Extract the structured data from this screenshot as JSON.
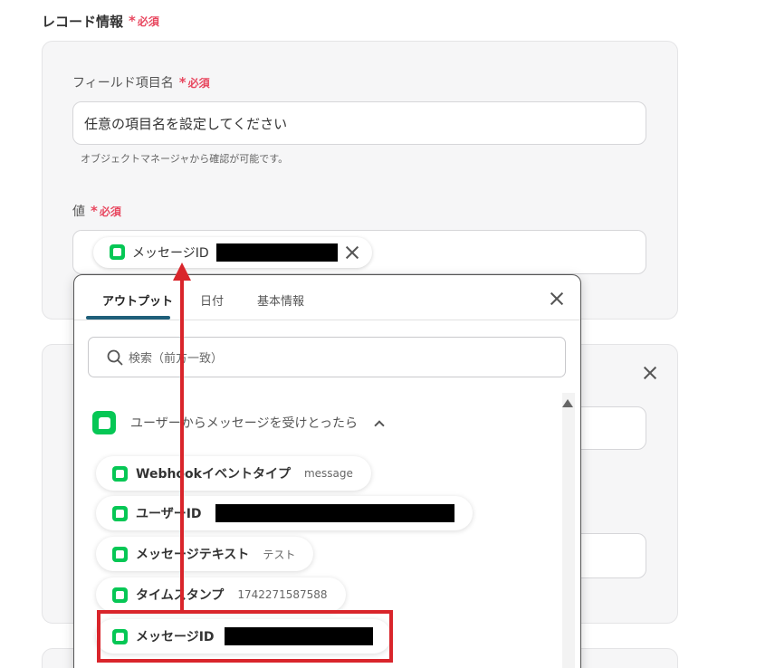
{
  "record_section": {
    "label": "レコード情報",
    "required": "必須"
  },
  "field_name": {
    "label": "フィールド項目名",
    "required": "必須",
    "value": "任意の項目名を設定してください",
    "hint": "オブジェクトマネージャから確認が可能です。"
  },
  "value_field": {
    "label": "値",
    "required": "必須",
    "chip_label": "メッセージID"
  },
  "dropdown": {
    "tabs": [
      {
        "label": "アウトプット"
      },
      {
        "label": "日付"
      },
      {
        "label": "基本情報"
      }
    ],
    "search_placeholder": "検索（前方一致）",
    "group_title": "ユーザーからメッセージを受けとったら",
    "items": [
      {
        "label": "Webhookイベントタイプ",
        "value": "message"
      },
      {
        "label": "ユーザーID",
        "value": ""
      },
      {
        "label": "メッセージテキスト",
        "value": "テスト"
      },
      {
        "label": "タイムスタンプ",
        "value": "1742271587588"
      },
      {
        "label": "メッセージID",
        "value": ""
      }
    ]
  },
  "colors": {
    "required_red": "#e8475f",
    "line_green": "#06c755",
    "tab_accent": "#1f5f7a",
    "annotation_red": "#d9252b"
  }
}
